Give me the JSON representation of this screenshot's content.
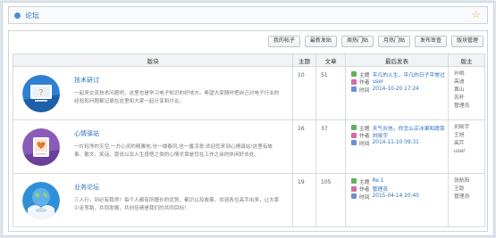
{
  "header": {
    "title": "论坛"
  },
  "toolbar": [
    "我的帖子",
    "最新发贴",
    "周热门贴",
    "月热门贴",
    "发布审查",
    "版块管理"
  ],
  "columns": [
    "版块",
    "主题",
    "文章",
    "最后发表",
    "版主"
  ],
  "labels": {
    "topic": "主题",
    "author": "作者",
    "time": "时间"
  },
  "boards": [
    {
      "name": "技术研讨",
      "desc": "一起来交流技术问题吧，这里也是学习电子知识的好地方。希望大家随时把自己对电子行业的经验和问题都记录在这里和大家一起分享和讨论。",
      "topics": "10",
      "posts": "51",
      "last": {
        "topic": "平凡的人生，平凡的日子平常过",
        "author": "user",
        "time": "2014-10-20 17:24"
      },
      "mods": [
        "孙桃",
        "高迪",
        "黄山",
        "苏杆",
        "管理员"
      ]
    },
    {
      "name": "心情驿站",
      "desc": "一片轻净的天空,一方心灵的精雅地,也一缕春风,也一番凉意;欢迎您来到心情驿站!这里有故事、散文、笑话、耍说以及人生感悟之类的心情文章是您在工作之余的休闲好去处。",
      "topics": "16",
      "posts": "37",
      "last": {
        "topic": "天气炎热，你怎么买冰果和蔬菜",
        "author": "刘晓宇",
        "time": "2014-11-10 09:31"
      },
      "mods": [
        "刘晓宇",
        "王旭",
        "高芹",
        "user"
      ]
    },
    {
      "name": "业务论坛",
      "desc": "三人行，到必有我师！每个人都有所擅长的优势、都识以及故事，欢迎各位高手出来，让大家少走弯路，共同发展，共创佳绩是我们的共同目标！",
      "topics": "19",
      "posts": "105",
      "last": {
        "topic": "Re 1",
        "author": "管理员",
        "time": "2015-04-14 20:40"
      },
      "mods": [
        "张航阳",
        "王助",
        "管理员"
      ]
    }
  ]
}
